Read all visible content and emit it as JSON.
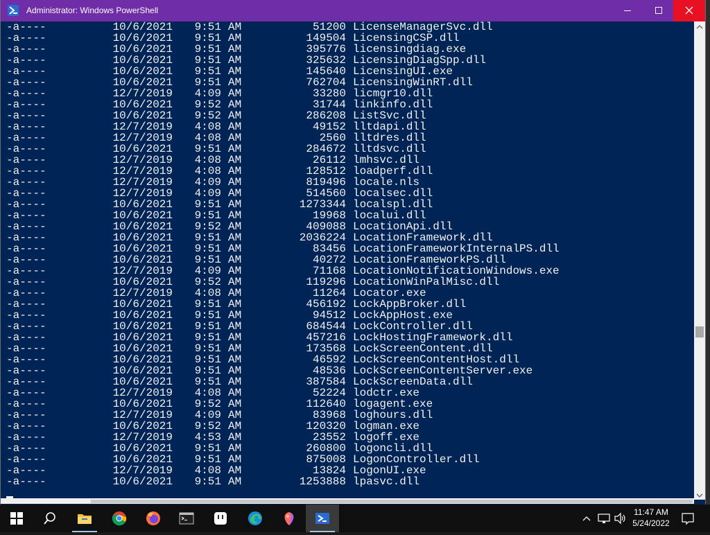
{
  "window": {
    "title": "Administrator: Windows PowerShell",
    "accent": "#6f2da8",
    "background": "#012456",
    "text_color": "#f2f2f2",
    "close_hover": "#e81123"
  },
  "listing": {
    "rows": [
      {
        "mode": "-a----",
        "date": "10/6/2021",
        "time": "9:51",
        "ampm": "AM",
        "length": "51200",
        "name": "LicenseManagerSvc.dll"
      },
      {
        "mode": "-a----",
        "date": "10/6/2021",
        "time": "9:51",
        "ampm": "AM",
        "length": "149504",
        "name": "LicensingCSP.dll"
      },
      {
        "mode": "-a----",
        "date": "10/6/2021",
        "time": "9:51",
        "ampm": "AM",
        "length": "395776",
        "name": "licensingdiag.exe"
      },
      {
        "mode": "-a----",
        "date": "10/6/2021",
        "time": "9:51",
        "ampm": "AM",
        "length": "325632",
        "name": "LicensingDiagSpp.dll"
      },
      {
        "mode": "-a----",
        "date": "10/6/2021",
        "time": "9:51",
        "ampm": "AM",
        "length": "145640",
        "name": "LicensingUI.exe"
      },
      {
        "mode": "-a----",
        "date": "10/6/2021",
        "time": "9:51",
        "ampm": "AM",
        "length": "762704",
        "name": "LicensingWinRT.dll"
      },
      {
        "mode": "-a----",
        "date": "12/7/2019",
        "time": "4:09",
        "ampm": "AM",
        "length": "33280",
        "name": "licmgr10.dll"
      },
      {
        "mode": "-a----",
        "date": "10/6/2021",
        "time": "9:52",
        "ampm": "AM",
        "length": "31744",
        "name": "linkinfo.dll"
      },
      {
        "mode": "-a----",
        "date": "10/6/2021",
        "time": "9:52",
        "ampm": "AM",
        "length": "286208",
        "name": "ListSvc.dll"
      },
      {
        "mode": "-a----",
        "date": "12/7/2019",
        "time": "4:08",
        "ampm": "AM",
        "length": "49152",
        "name": "lltdapi.dll"
      },
      {
        "mode": "-a----",
        "date": "12/7/2019",
        "time": "4:08",
        "ampm": "AM",
        "length": "2560",
        "name": "lltdres.dll"
      },
      {
        "mode": "-a----",
        "date": "10/6/2021",
        "time": "9:51",
        "ampm": "AM",
        "length": "284672",
        "name": "lltdsvc.dll"
      },
      {
        "mode": "-a----",
        "date": "12/7/2019",
        "time": "4:08",
        "ampm": "AM",
        "length": "26112",
        "name": "lmhsvc.dll"
      },
      {
        "mode": "-a----",
        "date": "12/7/2019",
        "time": "4:08",
        "ampm": "AM",
        "length": "128512",
        "name": "loadperf.dll"
      },
      {
        "mode": "-a----",
        "date": "12/7/2019",
        "time": "4:09",
        "ampm": "AM",
        "length": "819496",
        "name": "locale.nls"
      },
      {
        "mode": "-a----",
        "date": "12/7/2019",
        "time": "4:09",
        "ampm": "AM",
        "length": "514560",
        "name": "localsec.dll"
      },
      {
        "mode": "-a----",
        "date": "10/6/2021",
        "time": "9:51",
        "ampm": "AM",
        "length": "1273344",
        "name": "localspl.dll"
      },
      {
        "mode": "-a----",
        "date": "10/6/2021",
        "time": "9:51",
        "ampm": "AM",
        "length": "19968",
        "name": "localui.dll"
      },
      {
        "mode": "-a----",
        "date": "10/6/2021",
        "time": "9:52",
        "ampm": "AM",
        "length": "409088",
        "name": "LocationApi.dll"
      },
      {
        "mode": "-a----",
        "date": "10/6/2021",
        "time": "9:51",
        "ampm": "AM",
        "length": "2036224",
        "name": "LocationFramework.dll"
      },
      {
        "mode": "-a----",
        "date": "10/6/2021",
        "time": "9:51",
        "ampm": "AM",
        "length": "83456",
        "name": "LocationFrameworkInternalPS.dll"
      },
      {
        "mode": "-a----",
        "date": "10/6/2021",
        "time": "9:51",
        "ampm": "AM",
        "length": "40272",
        "name": "LocationFrameworkPS.dll"
      },
      {
        "mode": "-a----",
        "date": "12/7/2019",
        "time": "4:09",
        "ampm": "AM",
        "length": "71168",
        "name": "LocationNotificationWindows.exe"
      },
      {
        "mode": "-a----",
        "date": "10/6/2021",
        "time": "9:52",
        "ampm": "AM",
        "length": "119296",
        "name": "LocationWinPalMisc.dll"
      },
      {
        "mode": "-a----",
        "date": "12/7/2019",
        "time": "4:08",
        "ampm": "AM",
        "length": "11264",
        "name": "Locator.exe"
      },
      {
        "mode": "-a----",
        "date": "10/6/2021",
        "time": "9:51",
        "ampm": "AM",
        "length": "456192",
        "name": "LockAppBroker.dll"
      },
      {
        "mode": "-a----",
        "date": "10/6/2021",
        "time": "9:51",
        "ampm": "AM",
        "length": "94512",
        "name": "LockAppHost.exe"
      },
      {
        "mode": "-a----",
        "date": "10/6/2021",
        "time": "9:51",
        "ampm": "AM",
        "length": "684544",
        "name": "LockController.dll"
      },
      {
        "mode": "-a----",
        "date": "10/6/2021",
        "time": "9:51",
        "ampm": "AM",
        "length": "457216",
        "name": "LockHostingFramework.dll"
      },
      {
        "mode": "-a----",
        "date": "10/6/2021",
        "time": "9:51",
        "ampm": "AM",
        "length": "173568",
        "name": "LockScreenContent.dll"
      },
      {
        "mode": "-a----",
        "date": "10/6/2021",
        "time": "9:51",
        "ampm": "AM",
        "length": "46592",
        "name": "LockScreenContentHost.dll"
      },
      {
        "mode": "-a----",
        "date": "10/6/2021",
        "time": "9:51",
        "ampm": "AM",
        "length": "48536",
        "name": "LockScreenContentServer.exe"
      },
      {
        "mode": "-a----",
        "date": "10/6/2021",
        "time": "9:51",
        "ampm": "AM",
        "length": "387584",
        "name": "LockScreenData.dll"
      },
      {
        "mode": "-a----",
        "date": "12/7/2019",
        "time": "4:08",
        "ampm": "AM",
        "length": "52224",
        "name": "lodctr.exe"
      },
      {
        "mode": "-a----",
        "date": "10/6/2021",
        "time": "9:52",
        "ampm": "AM",
        "length": "112640",
        "name": "logagent.exe"
      },
      {
        "mode": "-a----",
        "date": "12/7/2019",
        "time": "4:09",
        "ampm": "AM",
        "length": "83968",
        "name": "loghours.dll"
      },
      {
        "mode": "-a----",
        "date": "10/6/2021",
        "time": "9:52",
        "ampm": "AM",
        "length": "120320",
        "name": "logman.exe"
      },
      {
        "mode": "-a----",
        "date": "12/7/2019",
        "time": "4:53",
        "ampm": "AM",
        "length": "23552",
        "name": "logoff.exe"
      },
      {
        "mode": "-a----",
        "date": "10/6/2021",
        "time": "9:51",
        "ampm": "AM",
        "length": "260800",
        "name": "logoncli.dll"
      },
      {
        "mode": "-a----",
        "date": "10/6/2021",
        "time": "9:51",
        "ampm": "AM",
        "length": "875008",
        "name": "LogonController.dll"
      },
      {
        "mode": "-a----",
        "date": "12/7/2019",
        "time": "4:08",
        "ampm": "AM",
        "length": "13824",
        "name": "LogonUI.exe"
      },
      {
        "mode": "-a----",
        "date": "10/6/2021",
        "time": "9:51",
        "ampm": "AM",
        "length": "1253888",
        "name": "lpasvc.dll"
      }
    ]
  },
  "scrollbar": {
    "vertical_position_fraction": 0.66
  },
  "taskbar": {
    "apps": [
      {
        "name": "start-button",
        "icon": "windows-logo-icon"
      },
      {
        "name": "search-button",
        "icon": "search-icon"
      },
      {
        "name": "file-explorer-button",
        "icon": "folder-icon"
      },
      {
        "name": "chrome-button",
        "icon": "chrome-icon"
      },
      {
        "name": "firefox-button",
        "icon": "firefox-icon"
      },
      {
        "name": "terminal-button",
        "icon": "terminal-icon"
      },
      {
        "name": "app-button",
        "icon": "app-icon"
      },
      {
        "name": "edge-button",
        "icon": "edge-icon"
      },
      {
        "name": "paint-button",
        "icon": "paint-icon"
      },
      {
        "name": "powershell-button",
        "icon": "powershell-icon"
      }
    ],
    "clock": {
      "time": "11:47 AM",
      "date": "5/24/2022"
    }
  }
}
